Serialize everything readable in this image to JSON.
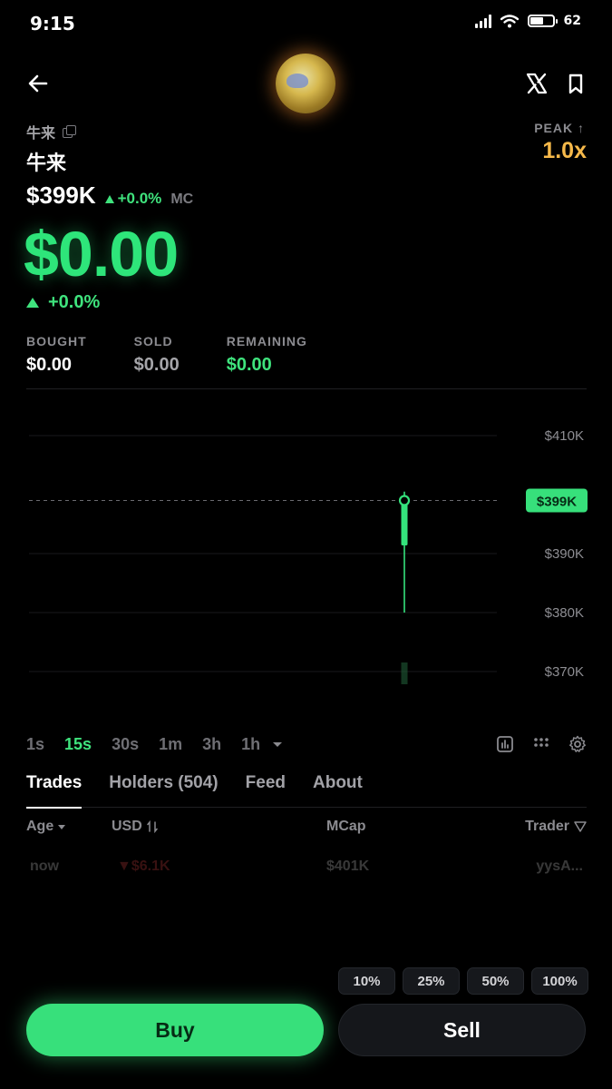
{
  "status_bar": {
    "time": "9:15",
    "battery": "62"
  },
  "header": {
    "avatar_icon": "token-avatar",
    "x_icon": "x-logo-icon",
    "bookmark_icon": "bookmark-icon"
  },
  "token": {
    "ticker": "牛来",
    "name": "牛来",
    "peak_label": "PEAK ↑",
    "peak_value": "1.0x",
    "market_cap": "$399K",
    "mc_change": "+0.0%",
    "mc_label": "MC",
    "price": "$0.00",
    "price_change": "+0.0%"
  },
  "position": {
    "bought_label": "BOUGHT",
    "bought_value": "$0.00",
    "sold_label": "SOLD",
    "sold_value": "$0.00",
    "remaining_label": "REMAINING",
    "remaining_value": "$0.00"
  },
  "chart_data": {
    "type": "candlestick",
    "y_ticks": [
      "$410K",
      "$390K",
      "$380K",
      "$370K"
    ],
    "y_tick_values": [
      410,
      390,
      380,
      370
    ],
    "current_label": "$399K",
    "current_value": 399,
    "candle": {
      "open": 399,
      "close": 396,
      "high": 400.5,
      "low": 380
    }
  },
  "timeframes": [
    "1s",
    "15s",
    "30s",
    "1m",
    "3h",
    "1h"
  ],
  "active_timeframe": "15s",
  "tabs": [
    "Trades",
    "Holders (504)",
    "Feed",
    "About"
  ],
  "active_tab": "Trades",
  "table": {
    "headers": {
      "age": "Age",
      "usd": "USD",
      "mcap": "MCap",
      "trader": "Trader"
    },
    "rows": [
      {
        "age": "now",
        "usd": "$6.1K",
        "mcap": "$401K",
        "trader": "yysA..."
      }
    ]
  },
  "trade": {
    "percents": [
      "10%",
      "25%",
      "50%",
      "100%"
    ],
    "buy_label": "Buy",
    "sell_label": "Sell"
  },
  "colors": {
    "green": "#2ee57a",
    "peak": "#f6b94a",
    "red": "#ff4d4d"
  }
}
